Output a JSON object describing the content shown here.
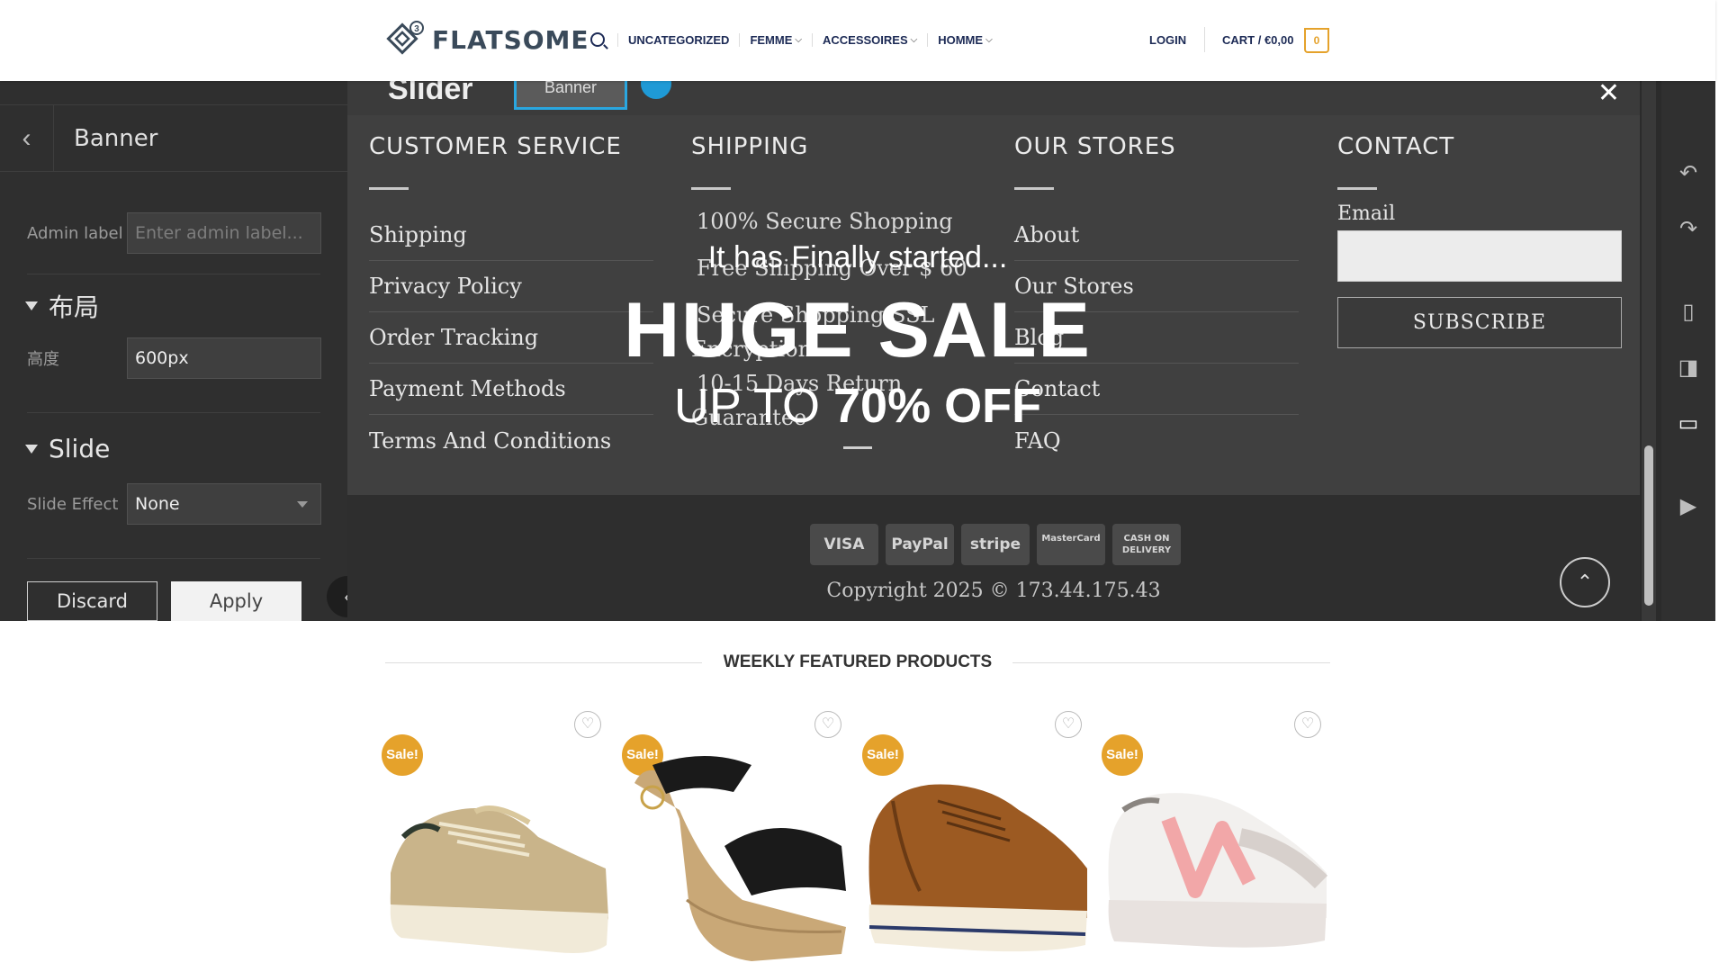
{
  "header": {
    "logo_text": "FLATSOME",
    "logo_badge": "3",
    "nav": [
      {
        "label": "UNCATEGORIZED",
        "chevron": false
      },
      {
        "label": "FEMME",
        "chevron": true
      },
      {
        "label": "ACCESSOIRES",
        "chevron": true
      },
      {
        "label": "HOMME",
        "chevron": true
      }
    ],
    "login": "LOGIN",
    "cart": "CART / €0,00",
    "cart_count": "0"
  },
  "builder_panel": {
    "title": "Banner",
    "admin_label": "Admin label",
    "admin_placeholder": "Enter admin label...",
    "layout_section": "布局",
    "height_label": "高度",
    "height_value": "600px",
    "slide_section": "Slide",
    "slide_effect_label": "Slide Effect",
    "slide_effect_value": "None",
    "discard": "Discard",
    "apply": "Apply"
  },
  "preview": {
    "slider_label": "Slider",
    "banner_chip": "Banner",
    "columns": {
      "customer_service": {
        "title": "CUSTOMER SERVICE",
        "links": [
          "Shipping",
          "Privacy Policy",
          "Order Tracking",
          "Payment Methods",
          "Terms And Conditions"
        ]
      },
      "shipping": {
        "title": "SHIPPING",
        "lines": [
          "100% Secure Shopping",
          "Free Shipping Over $ 60",
          "Secure Shopping SSL",
          "Encryption",
          "10-15 Days Return",
          "Guarantee"
        ]
      },
      "our_stores": {
        "title": "OUR STORES",
        "links": [
          "About",
          "Our Stores",
          "Blog",
          "Contact",
          "FAQ"
        ]
      },
      "contact": {
        "title": "CONTACT",
        "email_label": "Email",
        "subscribe": "SUBSCRIBE"
      }
    },
    "payments": [
      "VISA",
      "PayPal",
      "stripe",
      "MasterCard",
      "CASH ON DELIVERY"
    ],
    "copyright": "Copyright 2025 © 173.44.175.43"
  },
  "overlay": {
    "subtitle": "It has Finally started...",
    "title": "HUGE SALE",
    "offer_prefix": "UP TO ",
    "offer_bold": "70% OFF"
  },
  "products": {
    "section_title": "WEEKLY FEATURED PRODUCTS",
    "sale_badge": "Sale!",
    "items": [
      {
        "name": "gold-platform-sneaker"
      },
      {
        "name": "black-espadrille-wedge-sandal"
      },
      {
        "name": "brown-leather-zip-sneaker"
      },
      {
        "name": "pink-white-new-balance-sneaker"
      }
    ]
  },
  "colors": {
    "accent": "#e5a22b",
    "nav_text": "#1c2a55",
    "builder_bg": "#2f2f2f",
    "selection": "#2aa7e0"
  }
}
